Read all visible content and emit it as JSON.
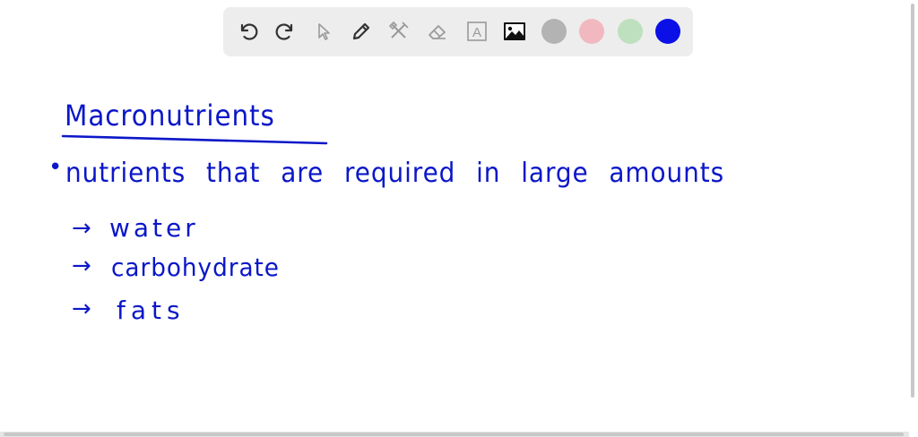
{
  "toolbar": {
    "tools": [
      {
        "name": "undo-icon"
      },
      {
        "name": "redo-icon"
      },
      {
        "name": "pointer-icon"
      },
      {
        "name": "pen-icon"
      },
      {
        "name": "tools-icon"
      },
      {
        "name": "eraser-icon"
      },
      {
        "name": "text-icon",
        "glyph": "A"
      },
      {
        "name": "image-icon"
      }
    ],
    "colors": [
      "#b3b3b3",
      "#f2b8c0",
      "#bfe0bf",
      "#0a10e6"
    ]
  },
  "note": {
    "title": "Macronutrients",
    "definition": "nutrients that are required in large amounts",
    "items": [
      "water",
      "carbohydrate",
      "fats"
    ],
    "bullet": "•",
    "arrow": "→",
    "ink_color": "#0b17c8"
  }
}
